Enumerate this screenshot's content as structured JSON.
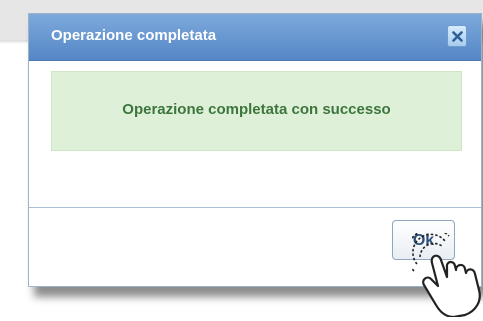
{
  "dialog": {
    "title": "Operazione completata",
    "close_icon": "close-icon",
    "message": "Operazione completata con successo",
    "ok_label": "Ok",
    "pointer_icon": "hand-pointer-icon"
  },
  "colors": {
    "titlebar": "#5a8ccb",
    "success_bg": "#dff0d8",
    "success_text": "#3c763d",
    "ok_text": "#2e4f7a"
  }
}
